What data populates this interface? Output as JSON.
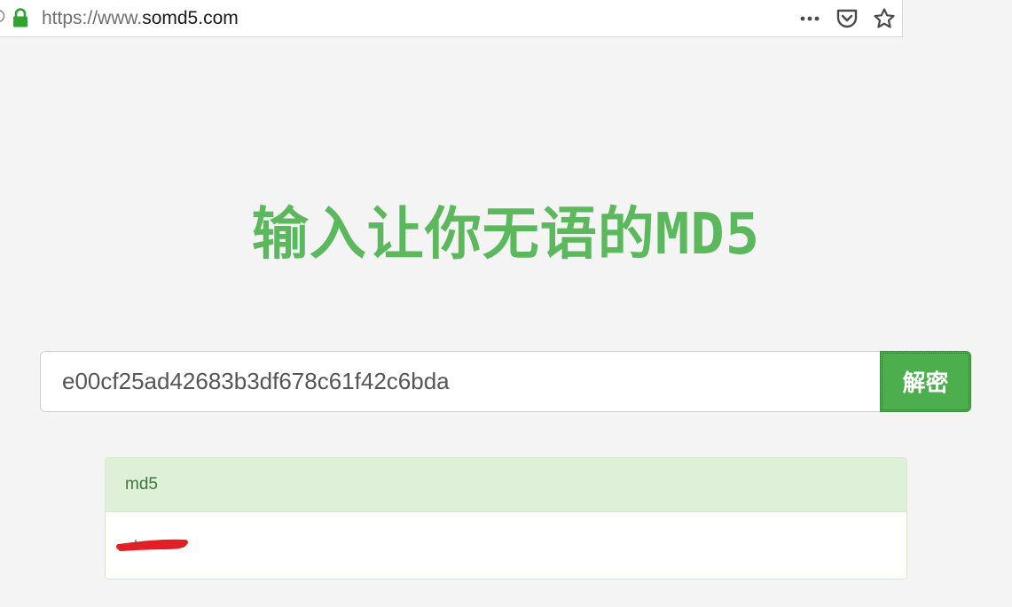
{
  "browser": {
    "url_prefix": "https://www.",
    "url_domain": "somd5.com",
    "icons": {
      "info": "info-icon",
      "lock": "lock-icon",
      "more": "more-actions-icon",
      "pocket": "pocket-icon",
      "bookmark": "bookmark-star-icon"
    },
    "lock_color": "#2ea52e"
  },
  "page": {
    "title": "输入让你无语的MD5",
    "title_color": "#5cb85c"
  },
  "search": {
    "value": "e00cf25ad42683b3df678c61f42c6bda",
    "button_label": "解密",
    "button_color": "#4cae4c"
  },
  "result": {
    "heading": "md5",
    "heading_bg": "#dff0d8",
    "redaction_color": "#e31e24"
  }
}
